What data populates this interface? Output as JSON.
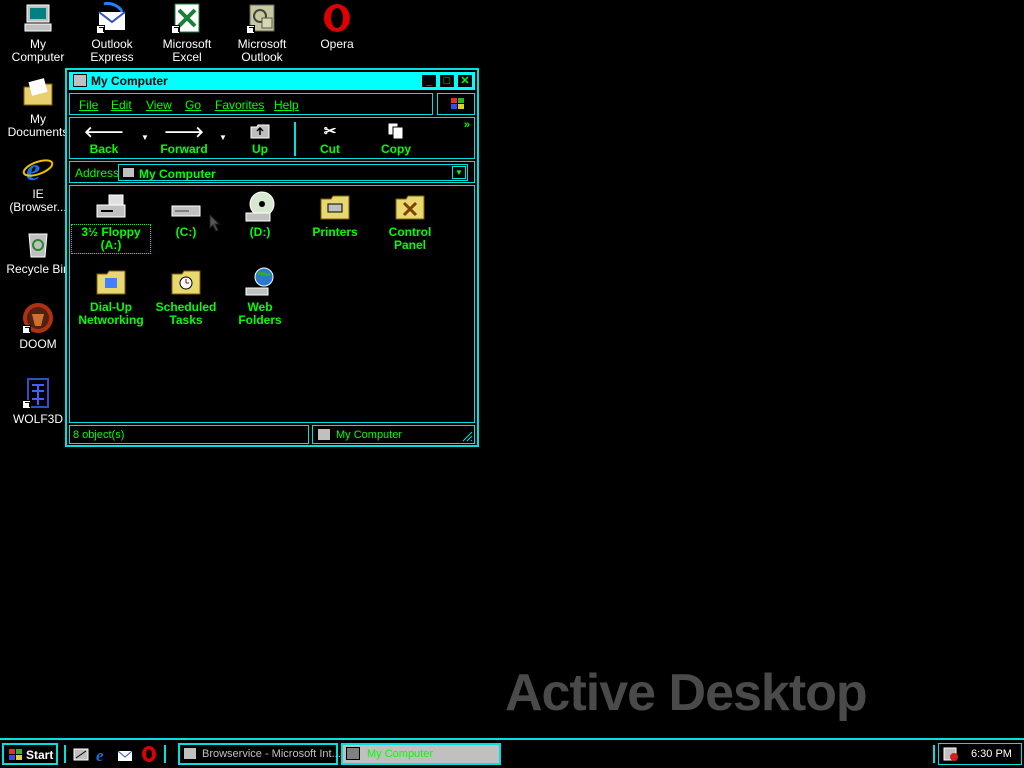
{
  "desktop": {
    "icons": [
      {
        "label": "My\nComputer",
        "icon": "my-computer-icon"
      },
      {
        "label": "Outlook\nExpress",
        "icon": "outlook-express-icon"
      },
      {
        "label": "Microsoft\nExcel",
        "icon": "excel-icon"
      },
      {
        "label": "Microsoft\nOutlook",
        "icon": "outlook-icon"
      },
      {
        "label": "Opera",
        "icon": "opera-icon"
      },
      {
        "label": "My\nDocuments",
        "icon": "my-documents-icon"
      },
      {
        "label": "IE\n(Browser...",
        "icon": "internet-explorer-icon"
      },
      {
        "label": "Recycle Bin",
        "icon": "recycle-bin-icon"
      },
      {
        "label": "DOOM",
        "icon": "doom-icon"
      },
      {
        "label": "WOLF3D",
        "icon": "wolf3d-icon"
      }
    ],
    "wallpaper_text": "Active Desktop"
  },
  "window": {
    "title": "My Computer",
    "controls": {
      "minimize": "_",
      "maximize": "□",
      "close": "✕"
    },
    "menu": [
      "File",
      "Edit",
      "View",
      "Go",
      "Favorites",
      "Help"
    ],
    "toolbar": {
      "back": "Back",
      "forward": "Forward",
      "up": "Up",
      "cut": "Cut",
      "copy": "Copy",
      "more": "»"
    },
    "address": {
      "label": "Address",
      "value": "My Computer"
    },
    "items": [
      {
        "label": "3½ Floppy\n(A:)",
        "icon": "floppy-drive-icon"
      },
      {
        "label": "(C:)",
        "icon": "hard-drive-icon"
      },
      {
        "label": "(D:)",
        "icon": "cd-drive-icon"
      },
      {
        "label": "Printers",
        "icon": "printers-folder-icon"
      },
      {
        "label": "Control\nPanel",
        "icon": "control-panel-icon"
      },
      {
        "label": "Dial-Up\nNetworking",
        "icon": "dial-up-networking-icon"
      },
      {
        "label": "Scheduled\nTasks",
        "icon": "scheduled-tasks-icon"
      },
      {
        "label": "Web\nFolders",
        "icon": "web-folders-icon"
      }
    ],
    "status": {
      "count": "8 object(s)",
      "location": "My Computer"
    }
  },
  "taskbar": {
    "start": "Start",
    "tasks": [
      {
        "label": "Browservice - Microsoft Int..."
      },
      {
        "label": "My Computer"
      }
    ],
    "clock": "6:30 PM"
  },
  "colors": {
    "accent": "#00ffff",
    "text": "#00ff00",
    "background": "#000000"
  }
}
